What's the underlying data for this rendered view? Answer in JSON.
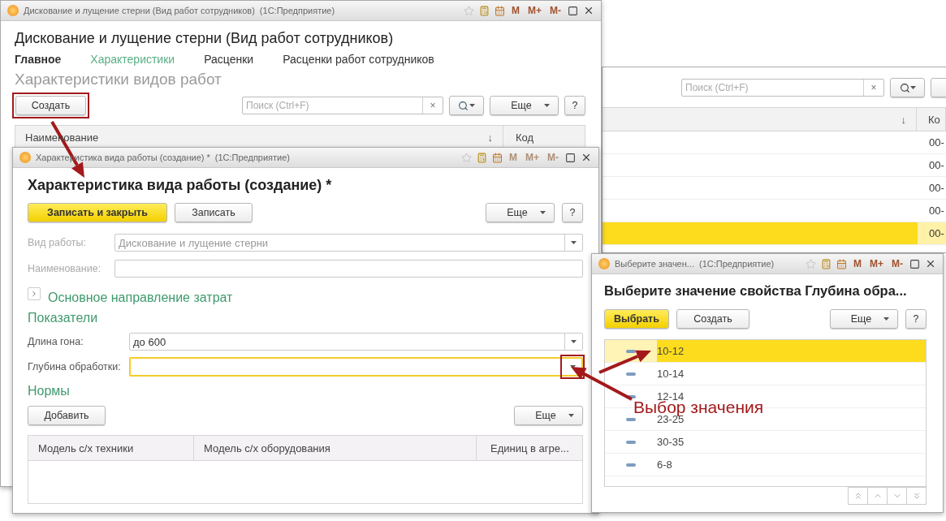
{
  "background_window": {
    "search_placeholder": "Поиск (Ctrl+F)",
    "search_clear": "×",
    "sort_mark": "↓",
    "code_column": "Ко",
    "rows": [
      {
        "code": "00-",
        "selected": false
      },
      {
        "code": "00-",
        "selected": false
      },
      {
        "code": "00-",
        "selected": false
      },
      {
        "code": "00-",
        "selected": false
      },
      {
        "code": "00-",
        "selected": true
      }
    ]
  },
  "main_window": {
    "title_bar": {
      "title": "Дискование и лущение стерни (Вид работ сотрудников)",
      "app": "(1С:Предприятие)",
      "memory_buttons": [
        "M",
        "M+",
        "M-"
      ],
      "memory_disabled": false
    },
    "heading": "Дискование и лущение стерни (Вид работ сотрудников)",
    "nav": [
      {
        "label": "Главное",
        "kind": "main",
        "selected": false
      },
      {
        "label": "Характеристики",
        "kind": "link",
        "selected": true
      },
      {
        "label": "Расценки",
        "kind": "link",
        "selected": false
      },
      {
        "label": "Расценки работ сотрудников",
        "kind": "link",
        "selected": false
      }
    ],
    "section_title": "Характеристики видов работ",
    "create_button": {
      "label": "Создать",
      "highlighted": true
    },
    "search": {
      "placeholder": "Поиск (Ctrl+F)",
      "clear": "×"
    },
    "more_button": "Еще",
    "help_button": "?",
    "table": {
      "columns": [
        "Наименование",
        "Код"
      ],
      "sort_mark": "↓"
    }
  },
  "form_window": {
    "title_bar": {
      "title": "Характеристика вида работы (создание) *",
      "app": "(1С:Предприятие)",
      "memory_buttons": [
        "M",
        "M+",
        "M-"
      ],
      "memory_disabled": true
    },
    "heading": "Характеристика вида работы (создание) *",
    "buttons": [
      {
        "label": "Записать и закрыть",
        "kind": "default"
      },
      {
        "label": "Записать",
        "kind": "normal"
      }
    ],
    "more_button": "Еще",
    "help_button": "?",
    "fields": [
      {
        "label": "Вид работы:",
        "value": "Дискование и лущение стерни",
        "disabled": true,
        "dropdown": true
      },
      {
        "label": "Наименование:",
        "disabled": true,
        "dropdown": false
      }
    ],
    "group": {
      "label": "Основное направление затрат",
      "expanded": false
    },
    "indicators_title": "Показатели",
    "indicators": [
      {
        "label": "Длина гона:",
        "value": "до 600",
        "focused": false,
        "highlighted": false
      },
      {
        "label": "Глубина обработки:",
        "focused": true,
        "highlighted": true
      }
    ],
    "norms_title": "Нормы",
    "add_button": "Добавить",
    "norms_more_button": "Еще",
    "norms_table": {
      "columns": [
        "Модель с/х техники",
        "Модель с/х оборудования",
        "Единиц в агре..."
      ]
    }
  },
  "choice_window": {
    "title_bar": {
      "title": "Выберите значен...",
      "app": "(1С:Предприятие)",
      "memory_buttons": [
        "M",
        "M+",
        "M-"
      ],
      "memory_disabled": false
    },
    "heading": "Выберите значение свойства Глубина обра...",
    "buttons": [
      {
        "label": "Выбрать",
        "kind": "default"
      },
      {
        "label": "Создать",
        "kind": "normal"
      }
    ],
    "more_button": "Еще",
    "help_button": "?",
    "items": [
      {
        "label": "10-12",
        "selected": true
      },
      {
        "label": "10-14",
        "selected": false
      },
      {
        "label": "12-14",
        "selected": false
      },
      {
        "label": "23-25",
        "selected": false
      },
      {
        "label": "30-35",
        "selected": false
      },
      {
        "label": "6-8",
        "selected": false
      }
    ]
  },
  "annotation": {
    "label": "Выбор значения"
  }
}
